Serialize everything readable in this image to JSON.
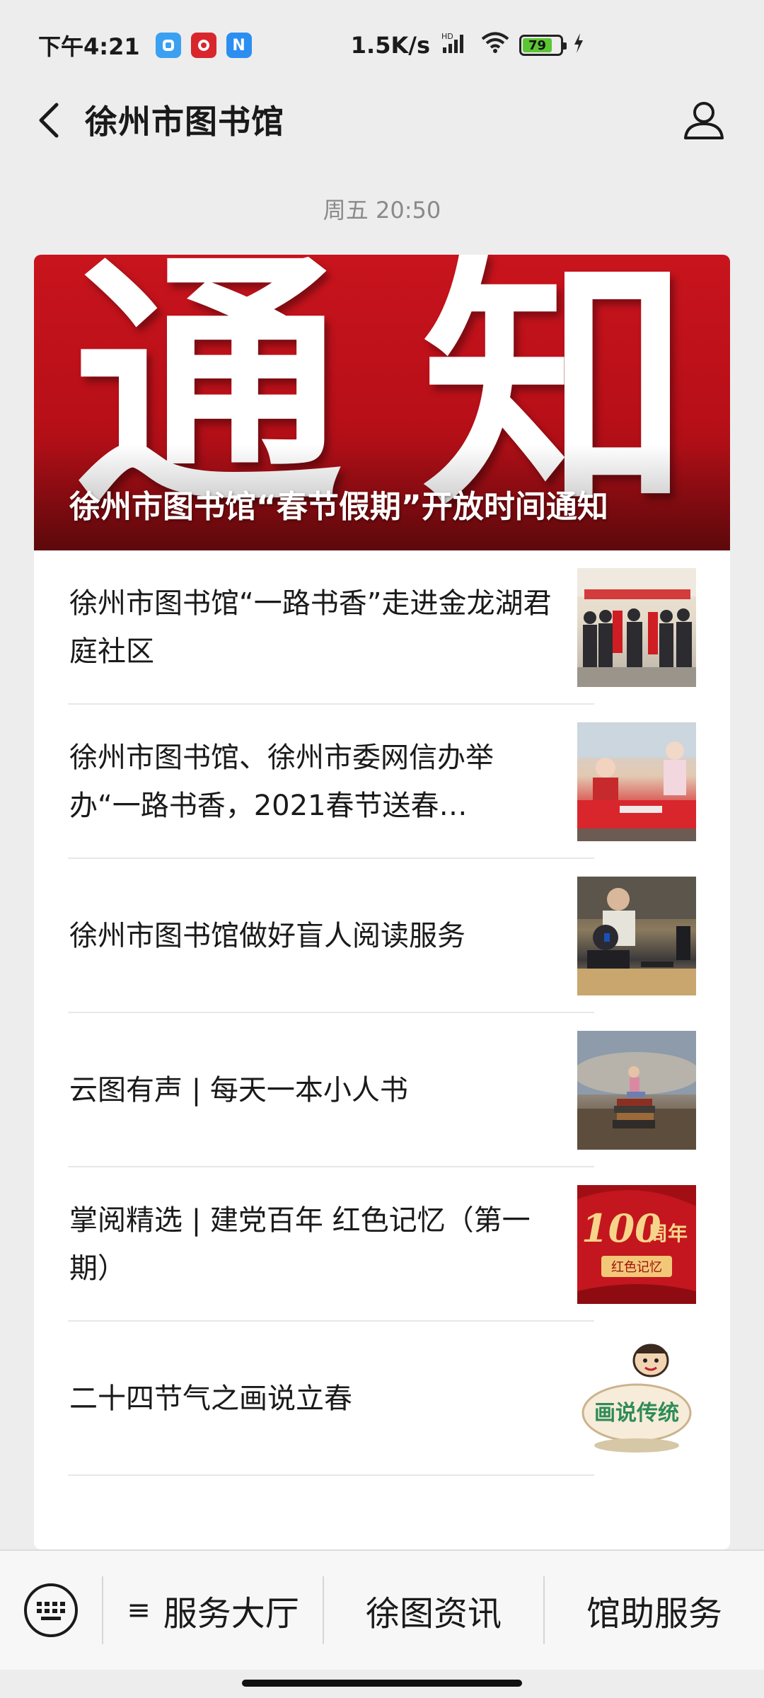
{
  "status_bar": {
    "time": "下午4:21",
    "net_speed": "1.5K/s",
    "hd_label": "HD",
    "battery_level": "79",
    "battery_fraction": 0.79,
    "badge_colors": [
      "#3aa0f2",
      "#d8262c",
      "#2b8ef0"
    ],
    "badge_labels": [
      "",
      "",
      "N"
    ]
  },
  "nav": {
    "title": "徐州市图书馆",
    "back_icon": "chevron-left-icon",
    "profile_icon": "person-icon"
  },
  "timestamp": "周五 20:50",
  "banner": {
    "art_text": [
      "通",
      "知"
    ],
    "title": "徐州市图书馆“春节假期”开放时间通知",
    "accent": "#c8141d"
  },
  "articles": [
    {
      "title": "徐州市图书馆“一路书香”走进金龙湖君庭社区",
      "thumb": "photo-group-couplets"
    },
    {
      "title": "徐州市图书馆、徐州市委网信办举办“一路书香，2021春节送春…",
      "thumb": "photo-calligraphy"
    },
    {
      "title": "徐州市图书馆做好盲人阅读服务",
      "thumb": "photo-reading-computer"
    },
    {
      "title": "云图有声 | 每天一本小人书",
      "thumb": "photo-girl-books"
    },
    {
      "title": "掌阅精选 | 建党百年 红色记忆（第一期）",
      "thumb": "poster-100-years",
      "thumb_text_big": "100",
      "thumb_text_small": "周年",
      "thumb_tag": "红色记忆"
    },
    {
      "title": "二十四节气之画说立春",
      "thumb": "cartoon-huashuo",
      "thumb_text": "画说传统"
    }
  ],
  "bottom_menu": {
    "keyboard_icon": "keyboard-icon",
    "items": [
      "服务大厅",
      "徐图资讯",
      "馆助服务"
    ],
    "first_item_marker": "≡"
  }
}
